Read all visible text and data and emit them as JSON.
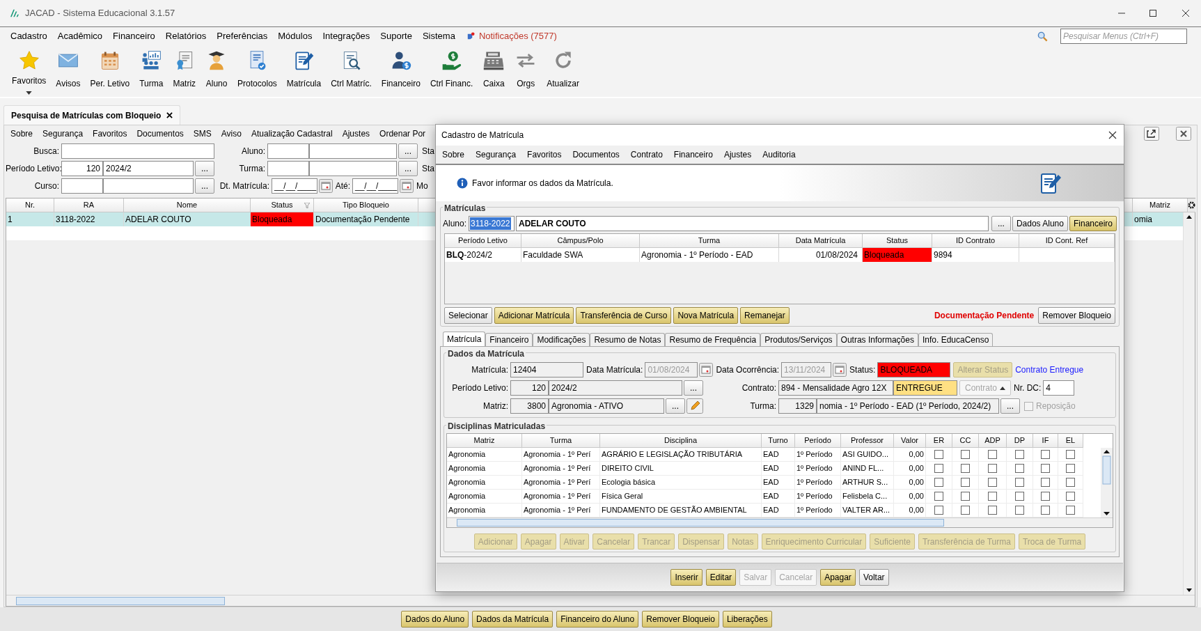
{
  "window": {
    "title": "JACAD - Sistema Educacional 3.1.57"
  },
  "menu": [
    {
      "label": "Cadastro"
    },
    {
      "label": "Acadêmico"
    },
    {
      "label": "Financeiro"
    },
    {
      "label": "Relatórios"
    },
    {
      "label": "Preferências"
    },
    {
      "label": "Módulos"
    },
    {
      "label": "Integrações"
    },
    {
      "label": "Suporte"
    },
    {
      "label": "Sistema"
    }
  ],
  "notifications": "Notificações (7577)",
  "menu_search": {
    "placeholder": "Pesquisar Menus (Ctrl+F)"
  },
  "toolbar": [
    {
      "label": "Favoritos"
    },
    {
      "label": "Avisos"
    },
    {
      "label": "Per. Letivo"
    },
    {
      "label": "Turma"
    },
    {
      "label": "Matriz"
    },
    {
      "label": "Aluno"
    },
    {
      "label": "Protocolos"
    },
    {
      "label": "Matrícula"
    },
    {
      "label": "Ctrl Matríc."
    },
    {
      "label": "Financeiro"
    },
    {
      "label": "Ctrl Financ."
    },
    {
      "label": "Caixa"
    },
    {
      "label": "Orgs"
    },
    {
      "label": "Atualizar"
    }
  ],
  "doc_tab": {
    "label": "Pesquisa de Matrículas com Bloqueio"
  },
  "search_panel": {
    "menu": [
      "Sobre",
      "Segurança",
      "Favoritos",
      "Documentos",
      "SMS",
      "Aviso",
      "Atualização Cadastral",
      "Ajustes",
      "Ordenar Por"
    ],
    "filters": {
      "busca": {
        "label": "Busca:"
      },
      "aluno": {
        "label": "Aluno:",
        "browse": "..."
      },
      "sta": "Sta",
      "periodo": {
        "label": "Período Letivo:",
        "code": "120",
        "value": "2024/2",
        "browse": "..."
      },
      "turma": {
        "label": "Turma:",
        "browse": "..."
      },
      "sta2": "Sta",
      "curso": {
        "label": "Curso:",
        "browse": "..."
      },
      "dt_matricula": {
        "label": "Dt. Matrícula:",
        "value": "__/__/____"
      },
      "ate": {
        "label": "Até:",
        "value": "__/__/____"
      },
      "mo": "Mo"
    },
    "columns": [
      "Nr.",
      "RA",
      "Nome",
      "Status",
      "Tipo Bloqueio"
    ],
    "right_column": "Matriz",
    "rows": [
      {
        "nr": "1",
        "ra": "3118-2022",
        "nome": "ADELAR COUTO",
        "status": {
          "text": "Bloqueada",
          "color": "#ff0000"
        },
        "tipo": "Documentação Pendente",
        "matriz": "omia",
        "selected": true
      }
    ],
    "buttons": [
      "Dados do Aluno",
      "Dados da Matrícula",
      "Financeiro do Aluno",
      "Remover Bloqueio",
      "Liberações"
    ]
  },
  "dialog": {
    "title": "Cadastro de Matrícula",
    "menu": [
      "Sobre",
      "Segurança",
      "Favoritos",
      "Documentos",
      "Contrato",
      "Financeiro",
      "Ajustes",
      "Auditoria"
    ],
    "info": "Favor informar os dados da Matrícula.",
    "matriculas": {
      "legend": "Matrículas",
      "aluno_label": "Aluno:",
      "aluno_ra": "3118-2022",
      "aluno_nome": "ADELAR COUTO",
      "aluno_buttons": [
        {
          "label": "...",
          "kind": "plain"
        },
        {
          "label": "Dados Aluno",
          "kind": "plain"
        },
        {
          "label": "Financeiro",
          "kind": "yellow"
        }
      ],
      "columns": [
        "Período Letivo",
        "Câmpus/Polo",
        "Turma",
        "Data Matrícula",
        "Status",
        "ID Contrato",
        "ID Cont. Ref"
      ],
      "rows": [
        {
          "periodo": "**BLQ**-2024/2",
          "campus": "Faculdade SWA",
          "turma": "Agronomia - 1º Período - EAD",
          "data": "01/08/2024",
          "status": {
            "text": "Bloqueada",
            "color": "#ff0000"
          },
          "id_contrato": "9894"
        }
      ],
      "buttons": [
        {
          "label": "Selecionar",
          "kind": "plain"
        },
        {
          "label": "Adicionar Matrícula",
          "kind": "yellow"
        },
        {
          "label": "Transferência de Curso",
          "kind": "yellow"
        },
        {
          "label": "Nova Matrícula",
          "kind": "yellow"
        },
        {
          "label": "Remanejar",
          "kind": "yellow"
        }
      ],
      "pending": "Documentação Pendente",
      "remove_button": {
        "label": "Remover Bloqueio",
        "kind": "plain"
      }
    },
    "tabs": [
      {
        "label": "Matrícula",
        "selected": true
      },
      {
        "label": "Financeiro",
        "selected": false
      },
      {
        "label": "Modificações",
        "selected": false
      },
      {
        "label": "Resumo de Notas",
        "selected": false
      },
      {
        "label": "Resumo de Frequência",
        "selected": false
      },
      {
        "label": "Produtos/Serviços",
        "selected": false
      },
      {
        "label": "Outras Informações",
        "selected": false
      },
      {
        "label": "Info. EducaCenso",
        "selected": false
      }
    ],
    "dados": {
      "legend": "Dados da Matrícula",
      "matricula": {
        "label": "Matrícula:",
        "value": "12404"
      },
      "data_matricula": {
        "label": "Data Matrícula:",
        "value": "01/08/2024",
        "disabled": true
      },
      "data_ocorrencia": {
        "label": "Data Ocorrência:",
        "value": "13/11/2024",
        "disabled": true
      },
      "status": {
        "label": "Status:",
        "value": "BLOQUEADA",
        "color": "#ff0000"
      },
      "alterar_status": {
        "label": "Alterar Status",
        "disabled": true
      },
      "contrato_link": "Contrato Entregue",
      "periodo": {
        "label": "Período Letivo:",
        "code": "120",
        "value": "2024/2",
        "browse": "..."
      },
      "contrato": {
        "label": "Contrato:",
        "value": "894 - Mensalidade Agro 12X",
        "situacao": {
          "text": "ENTREGUE",
          "color": "#ffe083"
        }
      },
      "contrato_button": {
        "label": "Contrato",
        "disabled": true
      },
      "nr_dc": {
        "label": "Nr. DC:",
        "value": "4"
      },
      "matriz": {
        "label": "Matriz:",
        "code": "3800",
        "value": "Agronomia - ATIVO",
        "browse": "..."
      },
      "turma": {
        "label": "Turma:",
        "code": "1329",
        "value": "nomia - 1º Período - EAD (1º Período, 2024/2)",
        "browse": "..."
      },
      "reposicao": {
        "label": "Reposição",
        "checked": false,
        "disabled": true
      }
    },
    "disciplinas": {
      "legend": "Disciplinas Matriculadas",
      "columns": [
        "Matriz",
        "Turma",
        "Disciplina",
        "Turno",
        "Período",
        "Professor",
        "Valor",
        "ER",
        "CC",
        "ADP",
        "DP",
        "IF",
        "EL"
      ],
      "rows": [
        {
          "matriz": "Agronomia",
          "turma": "Agronomia - 1º Perí",
          "disciplina": "AGRÁRIO E LEGISLAÇÃO TRIBUTÁRIA",
          "turno": "EAD",
          "periodo": "1º Período",
          "professor": "ASI GUIDO...",
          "valor": "0,00",
          "checks": [
            false,
            false,
            false,
            false,
            false,
            false
          ]
        },
        {
          "matriz": "Agronomia",
          "turma": "Agronomia - 1º Perí",
          "disciplina": "DIREITO CIVIL",
          "turno": "EAD",
          "periodo": "1º Período",
          "professor": "ANIND FL...",
          "valor": "0,00",
          "checks": [
            false,
            false,
            false,
            false,
            false,
            false
          ]
        },
        {
          "matriz": "Agronomia",
          "turma": "Agronomia - 1º Perí",
          "disciplina": "Ecologia básica",
          "turno": "EAD",
          "periodo": "1º Período",
          "professor": "ARTHUR S...",
          "valor": "0,00",
          "checks": [
            false,
            false,
            false,
            false,
            false,
            false
          ]
        },
        {
          "matriz": "Agronomia",
          "turma": "Agronomia - 1º Perí",
          "disciplina": "Física Geral",
          "turno": "EAD",
          "periodo": "1º Período",
          "professor": "Felisbela C...",
          "valor": "0,00",
          "checks": [
            false,
            false,
            false,
            false,
            false,
            false
          ]
        },
        {
          "matriz": "Agronomia",
          "turma": "Agronomia - 1º Perí",
          "disciplina": "FUNDAMENTO DE GESTÃO AMBIENTAL",
          "turno": "EAD",
          "periodo": "1º Período",
          "professor": "VALTER AR...",
          "valor": "0,00",
          "checks": [
            false,
            false,
            false,
            false,
            false,
            false
          ]
        }
      ],
      "buttons": [
        {
          "label": "Adicionar",
          "disabled": true
        },
        {
          "label": "Apagar",
          "disabled": true
        },
        {
          "label": "Ativar",
          "disabled": true
        },
        {
          "label": "Cancelar",
          "disabled": true
        },
        {
          "label": "Trancar",
          "disabled": true
        },
        {
          "label": "Dispensar",
          "disabled": true
        },
        {
          "label": "Notas",
          "disabled": true
        },
        {
          "label": "Enriquecimento Curricular",
          "disabled": true
        },
        {
          "label": "Suficiente",
          "disabled": true
        },
        {
          "label": "Transferência de Turma",
          "disabled": true
        },
        {
          "label": "Troca de Turma",
          "disabled": true
        }
      ]
    },
    "footer": [
      {
        "label": "Inserir",
        "kind": "yellow",
        "disabled": false
      },
      {
        "label": "Editar",
        "kind": "yellow",
        "disabled": false
      },
      {
        "label": "Salvar",
        "kind": "plain",
        "disabled": true
      },
      {
        "label": "Cancelar",
        "kind": "plain",
        "disabled": true
      },
      {
        "label": "Apagar",
        "kind": "yellow",
        "disabled": false
      },
      {
        "label": "Voltar",
        "kind": "plain",
        "disabled": false
      }
    ]
  }
}
